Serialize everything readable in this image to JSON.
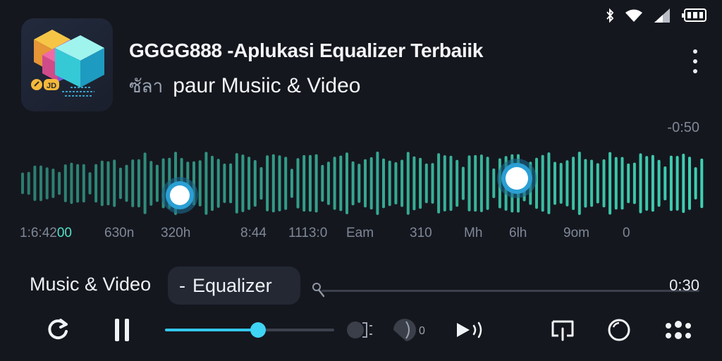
{
  "status_bar": {
    "icons": [
      "bluetooth-icon",
      "wifi-icon",
      "signal-icon",
      "battery-icon"
    ]
  },
  "app": {
    "icon": "app-cube-icon",
    "icon_text": "JD"
  },
  "header": {
    "title": "GGGG888 -Aplukasi Equalizer Terbaiik",
    "subtitle_prefix": "ซัลา",
    "subtitle": "paur Musiic & Video"
  },
  "waveform": {
    "time": "-0:50",
    "accent": "#3fd0b2",
    "labels": [
      {
        "text": "1:6:4200",
        "active_suffix": "00"
      },
      {
        "text": "630n"
      },
      {
        "text": "320h"
      },
      {
        "text": "8:44"
      },
      {
        "text": "1113:0"
      },
      {
        "text": "Eam"
      },
      {
        "text": "310"
      },
      {
        "text": "Mh"
      },
      {
        "text": "6lh"
      },
      {
        "text": "9om"
      },
      {
        "text": "0"
      }
    ]
  },
  "player": {
    "now_playing_label": "Music & Video",
    "chip_dash": "-",
    "chip_label": "Equalizer",
    "track_time": "0:30",
    "volume_level": 0.55,
    "active_color": "#3fd4f3"
  },
  "controls": {
    "icons": [
      "repeat-icon",
      "pause-icon",
      "mute-icon",
      "volume-icon",
      "next-icon",
      "cast-icon",
      "search-icon",
      "more-grid-icon"
    ],
    "volume_text": "0"
  }
}
